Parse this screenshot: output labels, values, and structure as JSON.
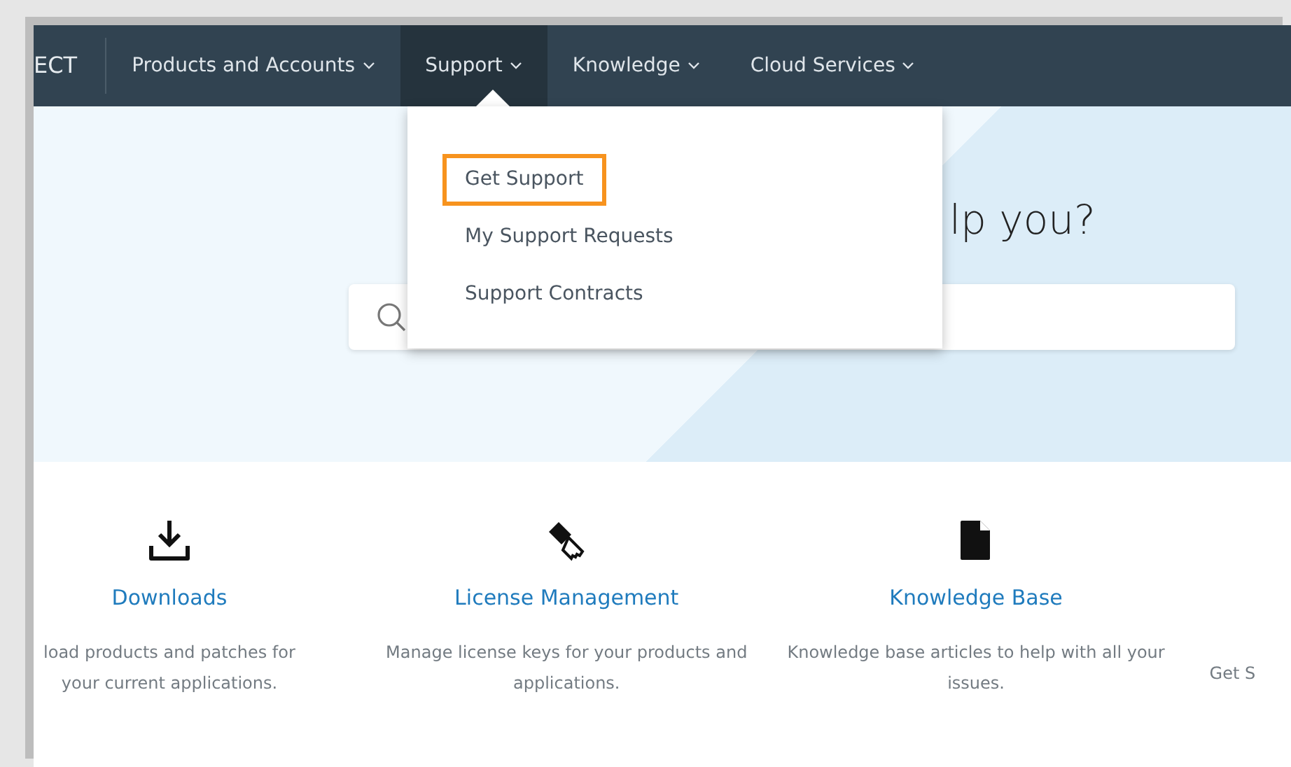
{
  "brand": "ECT",
  "nav": [
    {
      "label": "Products and Accounts",
      "selected": false
    },
    {
      "label": "Support",
      "selected": true
    },
    {
      "label": "Knowledge",
      "selected": false
    },
    {
      "label": "Cloud Services",
      "selected": false
    }
  ],
  "dropdown": [
    {
      "label": "Get Support",
      "selected": true
    },
    {
      "label": "My Support Requests",
      "selected": false
    },
    {
      "label": "Support Contracts",
      "selected": false
    }
  ],
  "hero": {
    "heading": "lp you?"
  },
  "cards": [
    {
      "kind": "download",
      "title": "Downloads",
      "description": "load products and patches for your current applications."
    },
    {
      "kind": "key",
      "title": "License Management",
      "description": "Manage license keys for your products and applications."
    },
    {
      "kind": "document",
      "title": "Knowledge Base",
      "description": "Knowledge base articles to help with all your issues."
    },
    {
      "kind": "none",
      "description": "Get S"
    }
  ]
}
